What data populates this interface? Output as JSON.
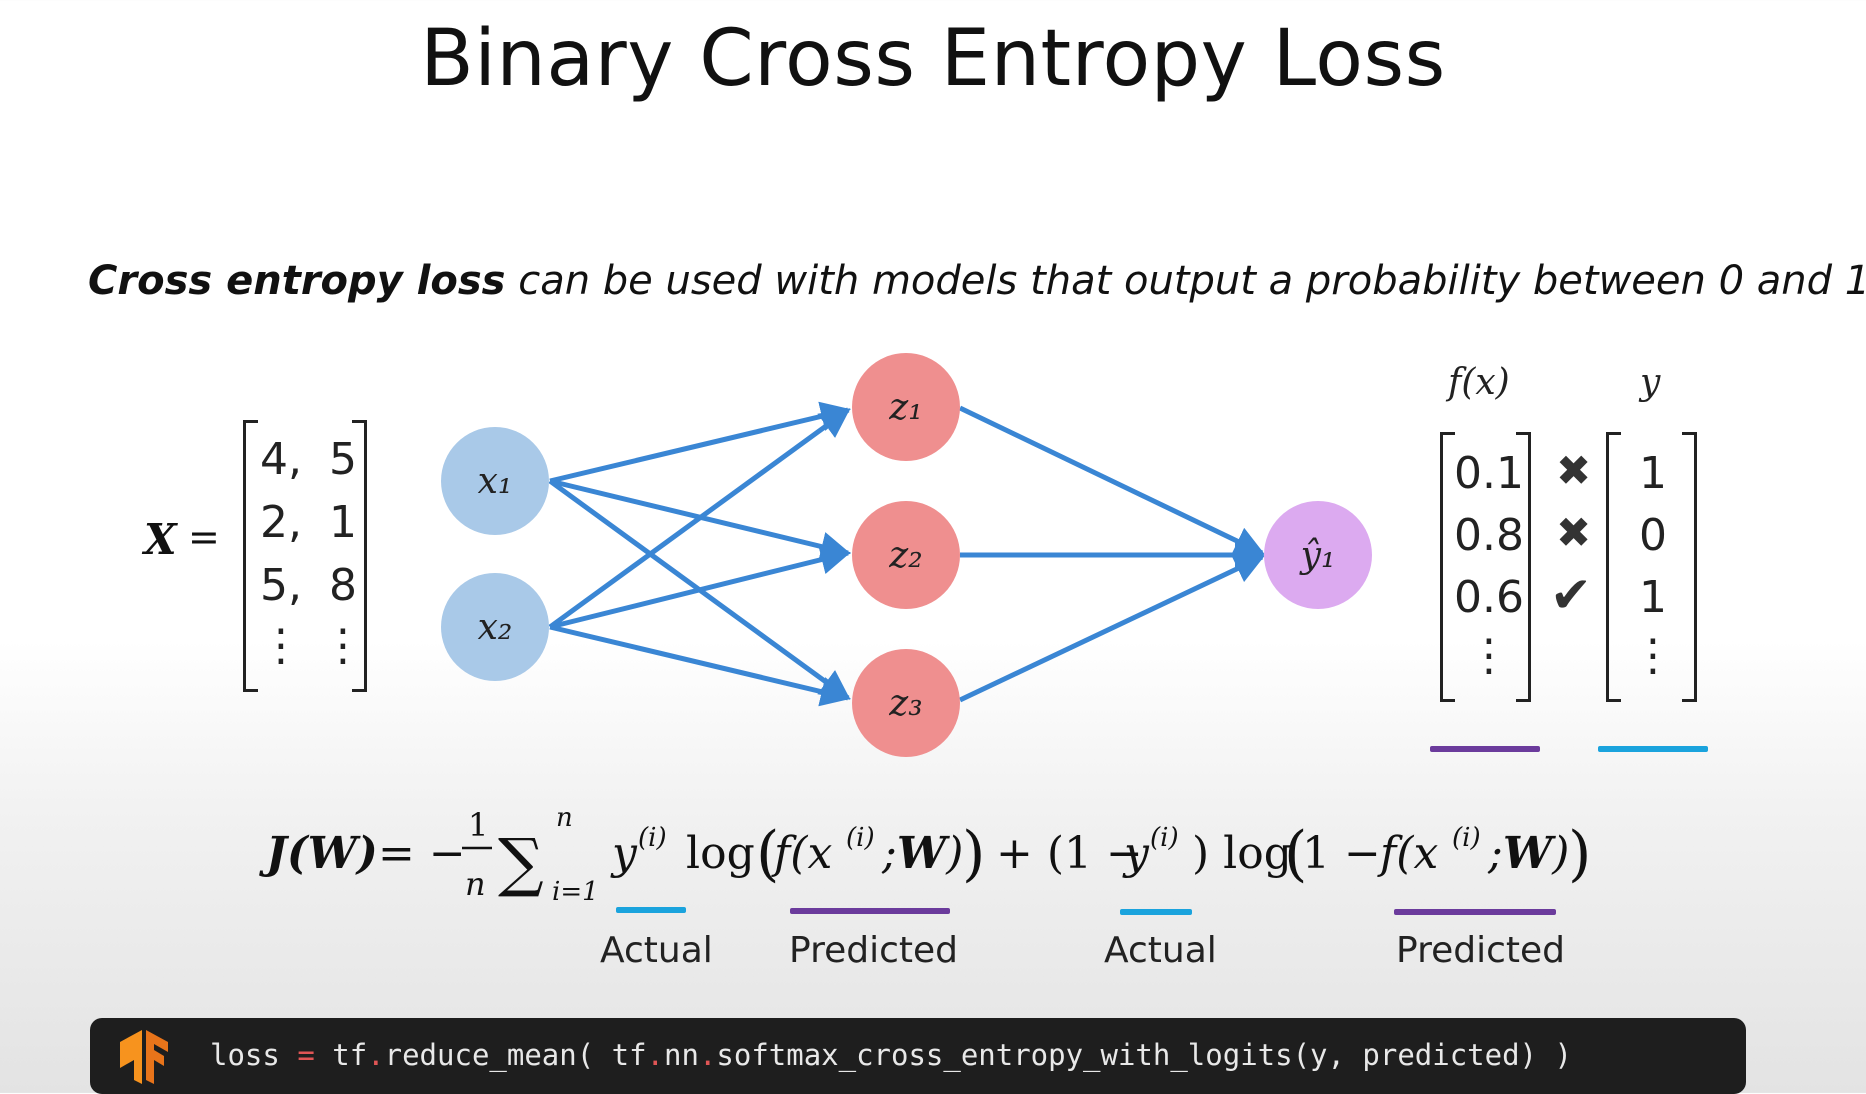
{
  "title": "Binary Cross Entropy Loss",
  "subtitle": {
    "bold": "Cross entropy loss",
    "rest": " can be used with models that output a probability between 0 and 1"
  },
  "matrix": {
    "label": "X",
    "equals": "=",
    "rows": [
      [
        "4,",
        "5"
      ],
      [
        "2,",
        "1"
      ],
      [
        "5,",
        "8"
      ],
      [
        "⋮",
        "⋮"
      ]
    ]
  },
  "network": {
    "inputs": [
      "x₁",
      "x₂"
    ],
    "hidden": [
      "z₁",
      "z₂",
      "z₃"
    ],
    "output": "ŷ₁",
    "colors": {
      "input": "#a9c9e8",
      "hidden": "#ef8f8f",
      "output": "#dcaaf0",
      "edge": "#3a86d4"
    }
  },
  "table": {
    "col_fx": "f(x)",
    "col_y": "y",
    "fx": [
      "0.1",
      "0.8",
      "0.6",
      "⋮"
    ],
    "marks": [
      "✖",
      "✖",
      "✔"
    ],
    "y": [
      "1",
      "0",
      "1",
      "⋮"
    ]
  },
  "equation": {
    "labels": [
      "Actual",
      "Predicted",
      "Actual",
      "Predicted"
    ]
  },
  "code": {
    "line": "loss = tf.reduce_mean( tf.nn.softmax_cross_entropy_with_logits(y, predicted) )",
    "logo": "tensorflow-logo"
  }
}
